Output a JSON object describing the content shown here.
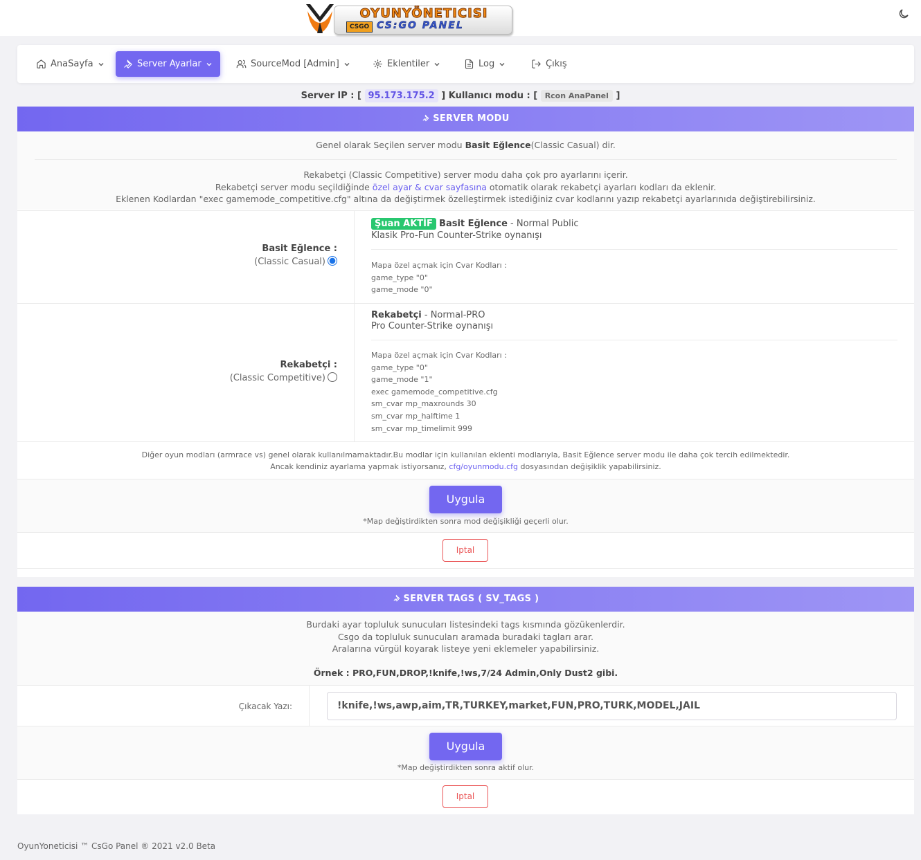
{
  "brand": {
    "logo_title": "OYUNYÖNETICISI",
    "logo_csgo_badge": "CSGO",
    "logo_sub": "CS:GO PANEL"
  },
  "topbar": {
    "theme_toggle_icon": "moon-icon"
  },
  "nav": [
    {
      "label": "AnaSayfa",
      "icon": "home-icon",
      "has_dropdown": true,
      "active": false
    },
    {
      "label": "Server Ayarlar",
      "icon": "wrench-icon",
      "has_dropdown": true,
      "active": true
    },
    {
      "label": "SourceMod [Admin]",
      "icon": "users-icon",
      "has_dropdown": true,
      "active": false
    },
    {
      "label": "Eklentiler",
      "icon": "puzzle-icon",
      "has_dropdown": true,
      "active": false
    },
    {
      "label": "Log",
      "icon": "file-icon",
      "has_dropdown": true,
      "active": false
    },
    {
      "label": "Çıkış",
      "icon": "logout-icon",
      "has_dropdown": false,
      "active": false
    }
  ],
  "server_info": {
    "ip_label": "Server IP : [",
    "ip": "95.173.175.2",
    "mode_label": "] Kullanıcı modu : [",
    "mode": "Rcon AnaPanel",
    "close": "]"
  },
  "server_mode": {
    "title": "SERVER MODU",
    "selected_prefix": "Genel olarak Seçilen server modu ",
    "selected_bold": "Basit Eğlence",
    "selected_suffix": "(Classic Casual) dir.",
    "info_line1": "Rekabetçi (Classic Competitive) server modu daha çok pro ayarlarını içerir.",
    "info_line2_a": "Rekabetçi server modu seçildiğinde ",
    "info_line2_link": "özel ayar & cvar sayfasına",
    "info_line2_b": " otomatik olarak rekabetçi ayarları kodları da eklenir.",
    "info_line3": "Eklenen Kodlardan \"exec gamemode_competitive.cfg\" altına da değiştirmek özelleştirmek istediğiniz cvar kodlarını yazıp rekabetçi ayarlarınıda değiştirebilirsiniz.",
    "modes": [
      {
        "name": "Basit Eğlence :",
        "sub": "(Classic Casual)",
        "checked": true,
        "active_badge": "Şuan AKTİF",
        "title": "Basit Eğlence",
        "title_suffix": " - Normal Public",
        "desc": "Klasik Pro-Fun Counter-Strike oynanışı",
        "cvar_header": "Mapa özel açmak için Cvar Kodları :",
        "cvars": [
          "game_type \"0\"",
          "game_mode \"0\""
        ]
      },
      {
        "name": "Rekabetçi :",
        "sub": "(Classic Competitive)",
        "checked": false,
        "title": "Rekabetçi",
        "title_suffix": " - Normal-PRO",
        "desc": "Pro Counter-Strike oynanışı",
        "cvar_header": "Mapa özel açmak için Cvar Kodları :",
        "cvars": [
          "game_type \"0\"",
          "game_mode \"1\"",
          "exec gamemode_competitive.cfg",
          "sm_cvar mp_maxrounds 30",
          "sm_cvar mp_halftime 1",
          "sm_cvar mp_timelimit 999"
        ]
      }
    ],
    "note_line1": "Diğer oyun modları (armrace vs) genel olarak kullanılmamaktadır.Bu modlar için kullanılan eklenti modlarıyla, Basit Eğlence server modu ile daha çok tercih edilmektedir.",
    "note_line2_a": "Ancak kendiniz ayarlama yapmak istiyorsanız, ",
    "note_line2_link": "cfg/oyunmodu.cfg",
    "note_line2_b": " dosyasından değişiklik yapabilirsiniz.",
    "apply_label": "Uygula",
    "apply_hint": "*Map değiştirdikten sonra mod değişikliği geçerli olur.",
    "cancel_label": "Iptal"
  },
  "server_tags": {
    "title": "SERVER TAGS ( SV_TAGS )",
    "info_line1": "Burdaki ayar topluluk sunucuları listesindeki tags kısmında gözükenlerdir.",
    "info_line2": "Csgo da topluluk sunucuları aramada buradaki tagları arar.",
    "info_line3": "Aralarına vürgül koyarak listeye yeni eklemeler yapabilirsiniz.",
    "example": "Örnek : PRO,FUN,DROP,!knife,!ws,7/24 Admin,Only Dust2 gibi.",
    "field_label": "Çıkacak Yazı:",
    "field_value": "!knife,!ws,awp,aim,TR,TURKEY,market,FUN,PRO,TURK,MODEL,JAIL",
    "apply_label": "Uygula",
    "apply_hint": "*Map değiştirdikten sonra aktif olur.",
    "cancel_label": "Iptal"
  },
  "footer": {
    "text": "OyunYoneticisi ™ CsGo Panel ® 2021 v2.0 Beta"
  }
}
